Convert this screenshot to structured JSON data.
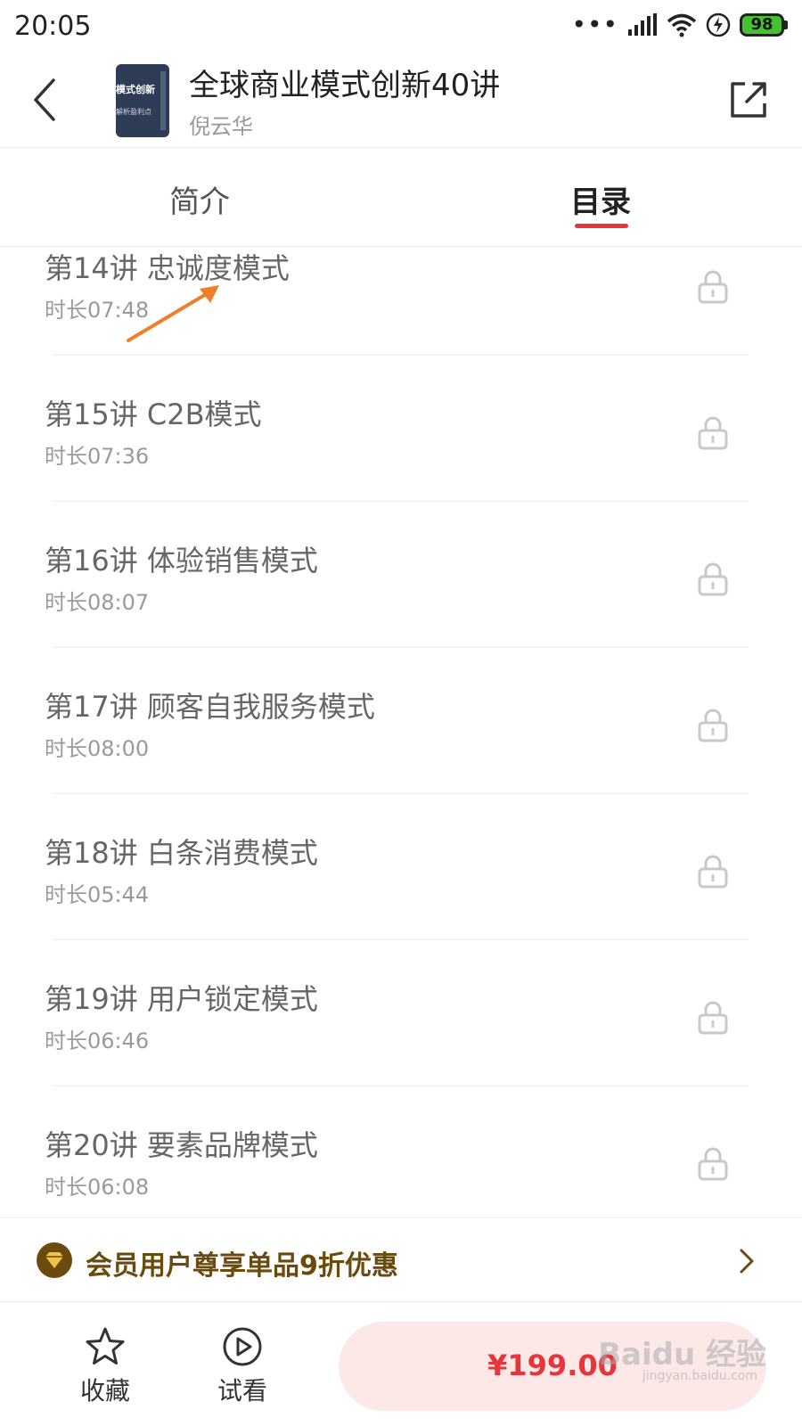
{
  "status_bar": {
    "time": "20:05",
    "signal_dots": "•••",
    "battery": "98"
  },
  "header": {
    "title": "全球商业模式创新40讲",
    "author": "倪云华",
    "cover_line1": "模式创新",
    "cover_line2": "解析盈利点"
  },
  "tabs": [
    {
      "label": "简介",
      "active": false
    },
    {
      "label": "目录",
      "active": true
    }
  ],
  "lessons": [
    {
      "title": "第14讲 忠诚度模式",
      "duration": "时长07:48",
      "locked": true
    },
    {
      "title": "第15讲 C2B模式",
      "duration": "时长07:36",
      "locked": true
    },
    {
      "title": "第16讲 体验销售模式",
      "duration": "时长08:07",
      "locked": true
    },
    {
      "title": "第17讲 顾客自我服务模式",
      "duration": "时长08:00",
      "locked": true
    },
    {
      "title": "第18讲 白条消费模式",
      "duration": "时长05:44",
      "locked": true
    },
    {
      "title": "第19讲 用户锁定模式",
      "duration": "时长06:46",
      "locked": true
    },
    {
      "title": "第20讲 要素品牌模式",
      "duration": "时长06:08",
      "locked": true
    }
  ],
  "promo": {
    "text": "会员用户尊享单品9折优惠"
  },
  "bottom_bar": {
    "favorite_label": "收藏",
    "preview_label": "试看",
    "price": "¥199.00"
  },
  "watermark": {
    "text": "Baidu 经验",
    "sub": "jingyan.baidu.com"
  },
  "colors": {
    "accent": "#e8343a",
    "promo_text": "#6b4a0e",
    "buy_bg": "#fde8e8"
  }
}
